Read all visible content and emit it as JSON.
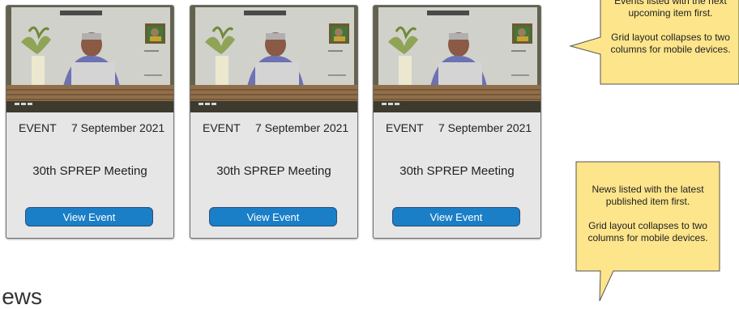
{
  "events": [
    {
      "type": "EVENT",
      "date": "7 September 2021",
      "title": "30th SPREP Meeting",
      "button": "View Event"
    },
    {
      "type": "EVENT",
      "date": "7 September 2021",
      "title": "30th SPREP Meeting",
      "button": "View Event"
    },
    {
      "type": "EVENT",
      "date": "7 September 2021",
      "title": "30th SPREP Meeting",
      "button": "View Event"
    }
  ],
  "notes": {
    "events": {
      "line1": "Events listed with the next",
      "line2": "upcoming item first.",
      "line3": "Grid layout collapses to two",
      "line4": "columns for mobile devices."
    },
    "news": {
      "line1": "News listed with the latest",
      "line2": "published item first.",
      "line3": "Grid layout collapses to two",
      "line4": "columns for mobile devices."
    }
  },
  "section": {
    "news_heading": "News"
  },
  "colors": {
    "button": "#1a7fc7",
    "note_fill": "#fde58b",
    "card_bg": "#e6e6e6"
  }
}
